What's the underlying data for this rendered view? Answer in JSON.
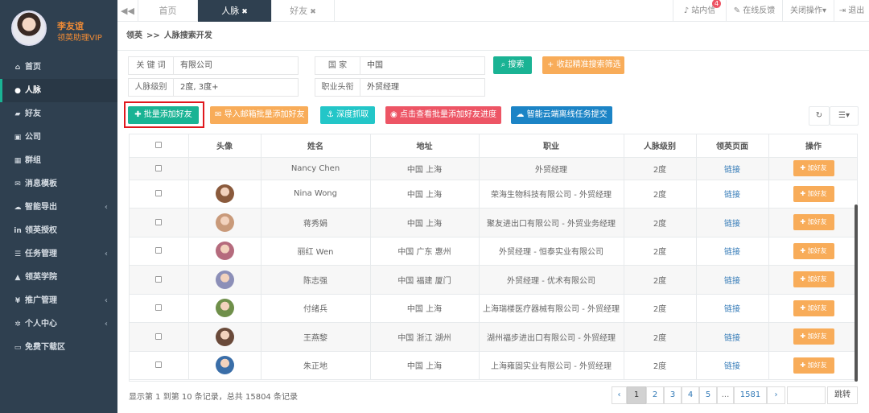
{
  "sidebar": {
    "user_name": "李友谊",
    "user_role": "领英助理VIP",
    "items": [
      {
        "label": "首页",
        "icon": "home-icon",
        "glyph": "⌂",
        "arrow": ""
      },
      {
        "label": "人脉",
        "icon": "user-icon",
        "glyph": "●",
        "arrow": ""
      },
      {
        "label": "好友",
        "icon": "chat-icon",
        "glyph": "▰",
        "arrow": ""
      },
      {
        "label": "公司",
        "icon": "building-icon",
        "glyph": "▣",
        "arrow": ""
      },
      {
        "label": "群组",
        "icon": "users-icon",
        "glyph": "▦",
        "arrow": ""
      },
      {
        "label": "消息模板",
        "icon": "envelope-icon",
        "glyph": "✉",
        "arrow": ""
      },
      {
        "label": "智能导出",
        "icon": "cloud-download-icon",
        "glyph": "☁",
        "arrow": "‹"
      },
      {
        "label": "领英授权",
        "icon": "linkedin-icon",
        "glyph": "in",
        "arrow": ""
      },
      {
        "label": "任务管理",
        "icon": "list-icon",
        "glyph": "☰",
        "arrow": "‹"
      },
      {
        "label": "领英学院",
        "icon": "graduation-icon",
        "glyph": "▲",
        "arrow": ""
      },
      {
        "label": "推广管理",
        "icon": "yen-icon",
        "glyph": "¥",
        "arrow": "‹"
      },
      {
        "label": "个人中心",
        "icon": "gear-icon",
        "glyph": "✲",
        "arrow": "‹"
      },
      {
        "label": "免费下载区",
        "icon": "card-icon",
        "glyph": "▭",
        "arrow": ""
      }
    ]
  },
  "topbar": {
    "tabs": [
      {
        "label": "首页",
        "close": ""
      },
      {
        "label": "人脉",
        "close": "✖"
      },
      {
        "label": "好友",
        "close": "✖"
      }
    ],
    "messages_label": "站内信",
    "messages_badge": "4",
    "feedback_label": "在线反馈",
    "close_ops_label": "关闭操作",
    "logout_label": "退出"
  },
  "breadcrumb": {
    "root": "领英",
    "sep": ">>",
    "current": "人脉搜索开发"
  },
  "filters": {
    "keyword_label": "关 键 词",
    "keyword_value": "有限公司",
    "country_label": "国    家",
    "country_value": "中国",
    "level_label": "人脉级别",
    "level_value": "2度, 3度+",
    "title_label": "职业头衔",
    "title_value": "外贸经理",
    "search_btn": "搜索",
    "collapse_btn": "收起精准搜索筛选"
  },
  "actions": {
    "batch_add": "批量添加好友",
    "import_email": "导入邮箱批量添加好友",
    "deep_crawl": "深度抓取",
    "view_progress": "点击查看批量添加好友进度",
    "cloud_task": "智能云端离线任务提交"
  },
  "table": {
    "headers": [
      "",
      "头像",
      "姓名",
      "地址",
      "职业",
      "人脉级别",
      "领英页面",
      "操作"
    ],
    "link_text": "链接",
    "add_text": "加好友",
    "rows": [
      {
        "name": "Nancy Chen",
        "address": "中国 上海",
        "job": "外贸经理",
        "level": "2度",
        "face": ""
      },
      {
        "name": "Nina Wong",
        "address": "中国 上海",
        "job": "荣海生物科技有限公司 - 外贸经理",
        "level": "2度",
        "face": "#8a5a3c"
      },
      {
        "name": "蒋秀娟",
        "address": "中国 上海",
        "job": "聚友进出口有限公司 - 外贸业务经理",
        "level": "2度",
        "face": "#c99a7a"
      },
      {
        "name": "丽红 Wen",
        "address": "中国 广东 惠州",
        "job": "外贸经理 - 恒泰实业有限公司",
        "level": "2度",
        "face": "#b56b7d"
      },
      {
        "name": "陈志强",
        "address": "中国 福建 厦门",
        "job": "外贸经理 - 优术有限公司",
        "level": "2度",
        "face": "#8c8fb8"
      },
      {
        "name": "付绪兵",
        "address": "中国 上海",
        "job": "上海瑞楼医疗器械有限公司 - 外贸经理",
        "level": "2度",
        "face": "#6f8f4a"
      },
      {
        "name": "王燕黎",
        "address": "中国 浙江 湖州",
        "job": "湖州福步进出口有限公司 - 外贸经理",
        "level": "2度",
        "face": "#6a4a3a"
      },
      {
        "name": "朱正地",
        "address": "中国 上海",
        "job": "上海雍固实业有限公司 - 外贸经理",
        "level": "2度",
        "face": "#3a6ea8"
      }
    ]
  },
  "footer": {
    "info": "显示第 1 到第 10 条记录，总共 15804 条记录",
    "pages": [
      "‹",
      "1",
      "2",
      "3",
      "4",
      "5",
      "...",
      "1581",
      "›"
    ],
    "jump_label": "跳转"
  }
}
